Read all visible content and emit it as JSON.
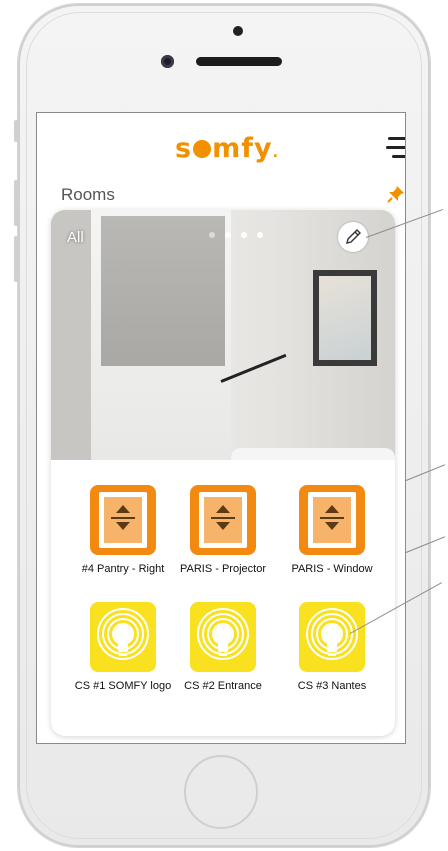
{
  "app": {
    "brand": "somfy",
    "brand_color": "#f29000"
  },
  "header": {
    "section_title": "Rooms"
  },
  "room_card": {
    "room_name": "All",
    "carousel_pages": 4,
    "carousel_active_index": 1
  },
  "devices": [
    {
      "label": "#4 Pantry - Right",
      "type": "shutter"
    },
    {
      "label": "PARIS - Projector",
      "type": "shutter"
    },
    {
      "label": "PARIS - Window",
      "type": "shutter"
    },
    {
      "label": "CS #1 SOMFY logo",
      "type": "light"
    },
    {
      "label": "CS #2 Entrance",
      "type": "light"
    },
    {
      "label": "CS #3 Nantes",
      "type": "light"
    }
  ],
  "colors": {
    "shutter_tile": "#f28a12",
    "light_tile": "#f9e11f"
  }
}
